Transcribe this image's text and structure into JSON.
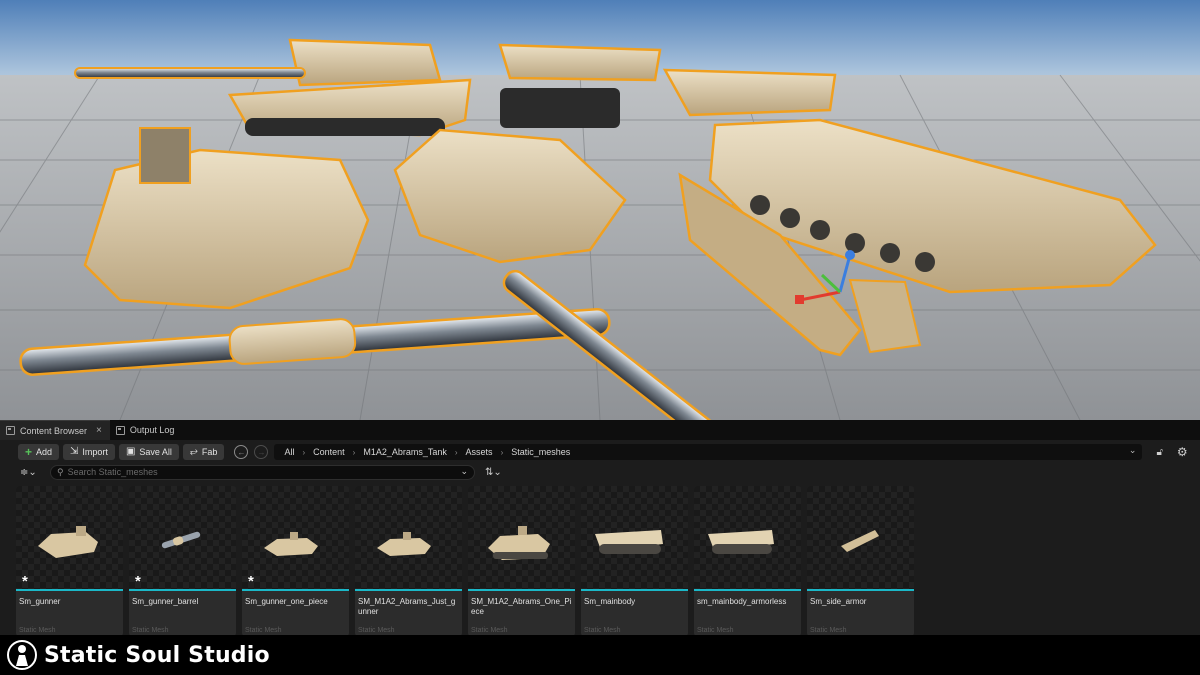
{
  "tabs": [
    {
      "label": "Content Browser",
      "close": "×"
    },
    {
      "label": "Output Log"
    }
  ],
  "toolbar": {
    "add_label": "Add",
    "import_label": "Import",
    "save_all_label": "Save All",
    "fab_label": "Fab"
  },
  "breadcrumb": [
    "All",
    "Content",
    "M1A2_Abrams_Tank",
    "Assets",
    "Static_meshes"
  ],
  "search": {
    "placeholder": "Search Static_meshes"
  },
  "assets": [
    {
      "name": "Sm_gunner",
      "type": "Static Mesh",
      "modified": "*"
    },
    {
      "name": "Sm_gunner_barrel",
      "type": "Static Mesh",
      "modified": "*"
    },
    {
      "name": "Sm_gunner_one_piece",
      "type": "Static Mesh",
      "modified": "*"
    },
    {
      "name": "SM_M1A2_Abrams_Just_gunner",
      "type": "Static Mesh",
      "modified": ""
    },
    {
      "name": "SM_M1A2_Abrams_One_Piece",
      "type": "Static Mesh",
      "modified": ""
    },
    {
      "name": "Sm_mainbody",
      "type": "Static Mesh",
      "modified": ""
    },
    {
      "name": "sm_mainbody_armorless",
      "type": "Static Mesh",
      "modified": ""
    },
    {
      "name": "Sm_side_armor",
      "type": "Static Mesh",
      "modified": ""
    }
  ],
  "footer": {
    "brand": "Static Soul Studio"
  },
  "colors": {
    "accent": "#1bb8c8",
    "selection_outline": "#f0a020",
    "tank": "#d8c4a0"
  }
}
